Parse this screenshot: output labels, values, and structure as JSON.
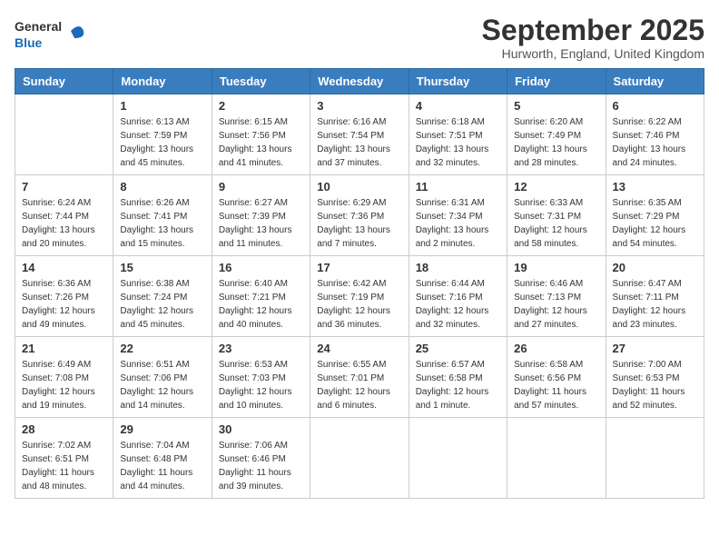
{
  "header": {
    "logo_general": "General",
    "logo_blue": "Blue",
    "month_title": "September 2025",
    "location": "Hurworth, England, United Kingdom"
  },
  "days_of_week": [
    "Sunday",
    "Monday",
    "Tuesday",
    "Wednesday",
    "Thursday",
    "Friday",
    "Saturday"
  ],
  "weeks": [
    [
      {
        "day": "",
        "sunrise": "",
        "sunset": "",
        "daylight": ""
      },
      {
        "day": "1",
        "sunrise": "Sunrise: 6:13 AM",
        "sunset": "Sunset: 7:59 PM",
        "daylight": "Daylight: 13 hours and 45 minutes."
      },
      {
        "day": "2",
        "sunrise": "Sunrise: 6:15 AM",
        "sunset": "Sunset: 7:56 PM",
        "daylight": "Daylight: 13 hours and 41 minutes."
      },
      {
        "day": "3",
        "sunrise": "Sunrise: 6:16 AM",
        "sunset": "Sunset: 7:54 PM",
        "daylight": "Daylight: 13 hours and 37 minutes."
      },
      {
        "day": "4",
        "sunrise": "Sunrise: 6:18 AM",
        "sunset": "Sunset: 7:51 PM",
        "daylight": "Daylight: 13 hours and 32 minutes."
      },
      {
        "day": "5",
        "sunrise": "Sunrise: 6:20 AM",
        "sunset": "Sunset: 7:49 PM",
        "daylight": "Daylight: 13 hours and 28 minutes."
      },
      {
        "day": "6",
        "sunrise": "Sunrise: 6:22 AM",
        "sunset": "Sunset: 7:46 PM",
        "daylight": "Daylight: 13 hours and 24 minutes."
      }
    ],
    [
      {
        "day": "7",
        "sunrise": "Sunrise: 6:24 AM",
        "sunset": "Sunset: 7:44 PM",
        "daylight": "Daylight: 13 hours and 20 minutes."
      },
      {
        "day": "8",
        "sunrise": "Sunrise: 6:26 AM",
        "sunset": "Sunset: 7:41 PM",
        "daylight": "Daylight: 13 hours and 15 minutes."
      },
      {
        "day": "9",
        "sunrise": "Sunrise: 6:27 AM",
        "sunset": "Sunset: 7:39 PM",
        "daylight": "Daylight: 13 hours and 11 minutes."
      },
      {
        "day": "10",
        "sunrise": "Sunrise: 6:29 AM",
        "sunset": "Sunset: 7:36 PM",
        "daylight": "Daylight: 13 hours and 7 minutes."
      },
      {
        "day": "11",
        "sunrise": "Sunrise: 6:31 AM",
        "sunset": "Sunset: 7:34 PM",
        "daylight": "Daylight: 13 hours and 2 minutes."
      },
      {
        "day": "12",
        "sunrise": "Sunrise: 6:33 AM",
        "sunset": "Sunset: 7:31 PM",
        "daylight": "Daylight: 12 hours and 58 minutes."
      },
      {
        "day": "13",
        "sunrise": "Sunrise: 6:35 AM",
        "sunset": "Sunset: 7:29 PM",
        "daylight": "Daylight: 12 hours and 54 minutes."
      }
    ],
    [
      {
        "day": "14",
        "sunrise": "Sunrise: 6:36 AM",
        "sunset": "Sunset: 7:26 PM",
        "daylight": "Daylight: 12 hours and 49 minutes."
      },
      {
        "day": "15",
        "sunrise": "Sunrise: 6:38 AM",
        "sunset": "Sunset: 7:24 PM",
        "daylight": "Daylight: 12 hours and 45 minutes."
      },
      {
        "day": "16",
        "sunrise": "Sunrise: 6:40 AM",
        "sunset": "Sunset: 7:21 PM",
        "daylight": "Daylight: 12 hours and 40 minutes."
      },
      {
        "day": "17",
        "sunrise": "Sunrise: 6:42 AM",
        "sunset": "Sunset: 7:19 PM",
        "daylight": "Daylight: 12 hours and 36 minutes."
      },
      {
        "day": "18",
        "sunrise": "Sunrise: 6:44 AM",
        "sunset": "Sunset: 7:16 PM",
        "daylight": "Daylight: 12 hours and 32 minutes."
      },
      {
        "day": "19",
        "sunrise": "Sunrise: 6:46 AM",
        "sunset": "Sunset: 7:13 PM",
        "daylight": "Daylight: 12 hours and 27 minutes."
      },
      {
        "day": "20",
        "sunrise": "Sunrise: 6:47 AM",
        "sunset": "Sunset: 7:11 PM",
        "daylight": "Daylight: 12 hours and 23 minutes."
      }
    ],
    [
      {
        "day": "21",
        "sunrise": "Sunrise: 6:49 AM",
        "sunset": "Sunset: 7:08 PM",
        "daylight": "Daylight: 12 hours and 19 minutes."
      },
      {
        "day": "22",
        "sunrise": "Sunrise: 6:51 AM",
        "sunset": "Sunset: 7:06 PM",
        "daylight": "Daylight: 12 hours and 14 minutes."
      },
      {
        "day": "23",
        "sunrise": "Sunrise: 6:53 AM",
        "sunset": "Sunset: 7:03 PM",
        "daylight": "Daylight: 12 hours and 10 minutes."
      },
      {
        "day": "24",
        "sunrise": "Sunrise: 6:55 AM",
        "sunset": "Sunset: 7:01 PM",
        "daylight": "Daylight: 12 hours and 6 minutes."
      },
      {
        "day": "25",
        "sunrise": "Sunrise: 6:57 AM",
        "sunset": "Sunset: 6:58 PM",
        "daylight": "Daylight: 12 hours and 1 minute."
      },
      {
        "day": "26",
        "sunrise": "Sunrise: 6:58 AM",
        "sunset": "Sunset: 6:56 PM",
        "daylight": "Daylight: 11 hours and 57 minutes."
      },
      {
        "day": "27",
        "sunrise": "Sunrise: 7:00 AM",
        "sunset": "Sunset: 6:53 PM",
        "daylight": "Daylight: 11 hours and 52 minutes."
      }
    ],
    [
      {
        "day": "28",
        "sunrise": "Sunrise: 7:02 AM",
        "sunset": "Sunset: 6:51 PM",
        "daylight": "Daylight: 11 hours and 48 minutes."
      },
      {
        "day": "29",
        "sunrise": "Sunrise: 7:04 AM",
        "sunset": "Sunset: 6:48 PM",
        "daylight": "Daylight: 11 hours and 44 minutes."
      },
      {
        "day": "30",
        "sunrise": "Sunrise: 7:06 AM",
        "sunset": "Sunset: 6:46 PM",
        "daylight": "Daylight: 11 hours and 39 minutes."
      },
      {
        "day": "",
        "sunrise": "",
        "sunset": "",
        "daylight": ""
      },
      {
        "day": "",
        "sunrise": "",
        "sunset": "",
        "daylight": ""
      },
      {
        "day": "",
        "sunrise": "",
        "sunset": "",
        "daylight": ""
      },
      {
        "day": "",
        "sunrise": "",
        "sunset": "",
        "daylight": ""
      }
    ]
  ]
}
